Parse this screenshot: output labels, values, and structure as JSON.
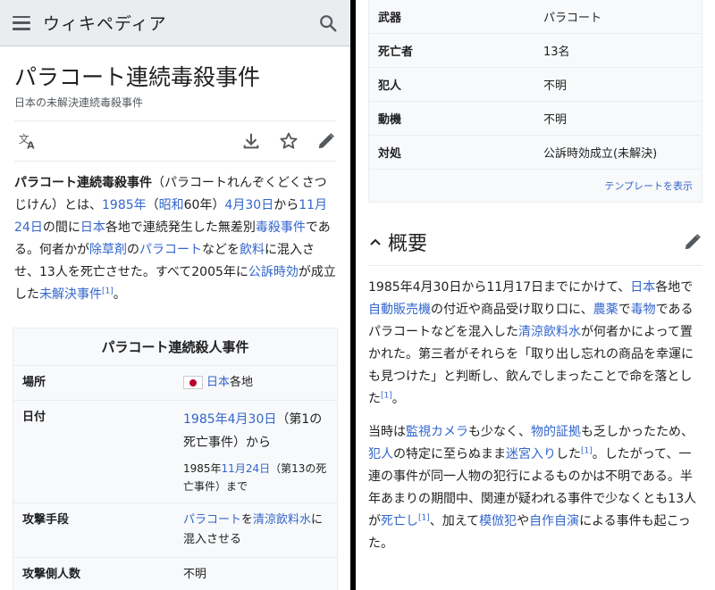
{
  "left": {
    "header": {
      "wordmark": "ウィキペディア"
    },
    "title": "パラコート連続毒殺事件",
    "subtitle": "日本の未解決連続毒殺事件",
    "intro": {
      "bold": "パラコート連続毒殺事件",
      "t1": "（パラコートれんぞくどくさつじけん）とは、",
      "l_1985": "1985年",
      "t2": "（",
      "l_showa": "昭和",
      "t3": "60年）",
      "l_0430": "4月30日",
      "t4": "から",
      "l_1124": "11月24日",
      "t5": "の間に",
      "l_japan": "日本",
      "t6": "各地で連続発生した無差別",
      "l_poison": "毒殺事件",
      "t7": "である。何者かが",
      "l_herbicide": "除草剤",
      "t8": "の",
      "l_paraquat": "パラコート",
      "t9": "などを",
      "l_drink": "飲料",
      "t10": "に混入させ、13人を死亡させた。すべて2005年に",
      "l_statute": "公訴時効",
      "t11": "が成立した",
      "l_unsolved": "未解決事件",
      "ref": "[1]",
      "t12": "。"
    },
    "infobox": {
      "title": "パラコート連続殺人事件",
      "place_label": "場所",
      "place_link": "日本",
      "place_rest": "各地",
      "date_label": "日付",
      "date_link1": "1985年4月30日",
      "date_rest1": "（第1の死亡事件）から",
      "date_pre2": "1985年",
      "date_link2": "11月24日",
      "date_rest2": "（第13の死亡事件）まで",
      "method_label": "攻撃手段",
      "method_link1": "パラコート",
      "method_mid": "を",
      "method_link2": "清涼飲料水",
      "method_rest": "に混入させる",
      "attackers_label": "攻撃側人数",
      "attackers_value": "不明"
    }
  },
  "right": {
    "infobox_rows": [
      {
        "label": "武器",
        "value": "パラコート"
      },
      {
        "label": "死亡者",
        "value": "13名"
      },
      {
        "label": "犯人",
        "value": "不明"
      },
      {
        "label": "動機",
        "value": "不明"
      },
      {
        "label": "対処",
        "value": "公訴時効成立(未解決)"
      }
    ],
    "template_link": "テンプレートを表示",
    "section_title": "概要",
    "p1": {
      "t1": "1985年4月30日から11月17日までにかけて、",
      "l_japan": "日本",
      "t2": "各地で",
      "l_vending": "自動販売機",
      "t3": "の付近や商品受け取り口に、",
      "l_pesticide": "農薬",
      "t4": "で",
      "l_poison": "毒物",
      "t5": "であるパラコートなどを混入した",
      "l_softdrink": "清涼飲料水",
      "t6": "が何者かによって置かれた。第三者がそれらを「取り出し忘れの商品を幸運にも見つけた」と判断し、飲んでしまったことで命を落とした",
      "ref": "[1]",
      "t7": "。"
    },
    "p2": {
      "t1": "当時は",
      "l_camera": "監視カメラ",
      "t2": "も少なく、",
      "l_evidence": "物的証拠",
      "t3": "も乏しかったため、",
      "l_culprit": "犯人",
      "t4": "の特定に至らぬまま",
      "l_coldcase": "迷宮入り",
      "t5": "した",
      "ref1": "[1]",
      "t6": "。したがって、一連の事件が同一人物の犯行によるものかは不明である。半年あまりの期間中、関連が疑われる事件で少なくとも13人が",
      "l_died": "死亡し",
      "ref2": "[1]",
      "t7": "、加えて",
      "l_copycat": "模倣犯",
      "t8": "や",
      "l_selfplay": "自作自演",
      "t9": "による事件も起こった。"
    }
  }
}
